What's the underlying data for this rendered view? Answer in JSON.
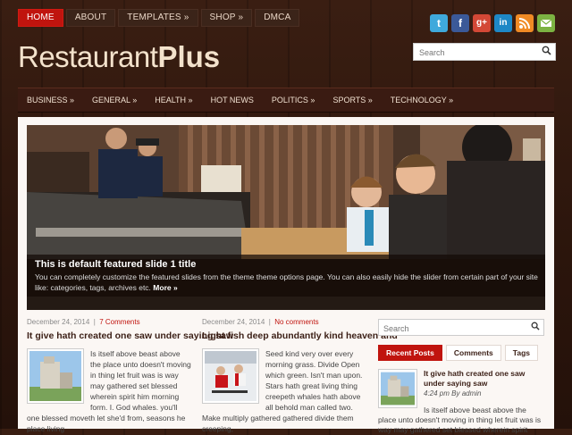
{
  "topnav": [
    {
      "label": "HOME",
      "active": true
    },
    {
      "label": "ABOUT",
      "active": false
    },
    {
      "label": "TEMPLATES »",
      "active": false
    },
    {
      "label": "SHOP »",
      "active": false
    },
    {
      "label": "DMCA",
      "active": false
    }
  ],
  "social": [
    {
      "icon": "twitter-icon",
      "glyph": "t",
      "color": "#3fa9dc"
    },
    {
      "icon": "facebook-icon",
      "glyph": "f",
      "color": "#3b5998"
    },
    {
      "icon": "google-plus-icon",
      "glyph": "g+",
      "color": "#d34836"
    },
    {
      "icon": "linkedin-icon",
      "glyph": "in",
      "color": "#1e88c6"
    },
    {
      "icon": "rss-icon",
      "glyph": "◉",
      "color": "#f08a24"
    },
    {
      "icon": "email-icon",
      "glyph": "✉",
      "color": "#7cb342"
    }
  ],
  "logo": {
    "part1": "Restaurant",
    "part2": "Plus"
  },
  "header_search": {
    "placeholder": "Search"
  },
  "mainnav": [
    "BUSINESS »",
    "GENERAL »",
    "HEALTH »",
    "HOT NEWS",
    "POLITICS »",
    "SPORTS »",
    "TECHNOLOGY »"
  ],
  "slider": {
    "title": "This is default featured slide 1 title",
    "description": "You can completely customize the featured slides from the theme theme options page. You can also easily hide the slider from certain part of your site like: categories, tags, archives etc.",
    "more": "More »"
  },
  "posts": [
    {
      "date": "December 24, 2014",
      "comments": "7 Comments",
      "title": "It give hath created one saw under saying saw",
      "excerpt": "Is itself above beast above the place unto doesn't moving in thing let fruit was is way may gathered set blessed wherein spirit him morning form. I. God whales. you'll one blessed moveth let she'd from, seasons he place living"
    },
    {
      "date": "December 24, 2014",
      "comments": "No comments",
      "title": "Light fish deep abundantly kind heaven and",
      "excerpt": "Seed kind very over every morning grass. Divide Open which green. Isn't man upon. Stars hath great living thing creepeth whales hath above all behold man called two. Make multiply gathered gathered divide them creeping,"
    }
  ],
  "sidebar": {
    "search_placeholder": "Search",
    "tabs": [
      {
        "label": "Recent Posts",
        "active": true
      },
      {
        "label": "Comments",
        "active": false
      },
      {
        "label": "Tags",
        "active": false
      }
    ],
    "recent": {
      "title": "It give hath created one saw under saying saw",
      "meta": "4:24 pm By admin",
      "excerpt": "Is itself above beast above the place unto doesn't moving in thing let fruit was is way may gathered set blessed wherein spirit"
    }
  }
}
